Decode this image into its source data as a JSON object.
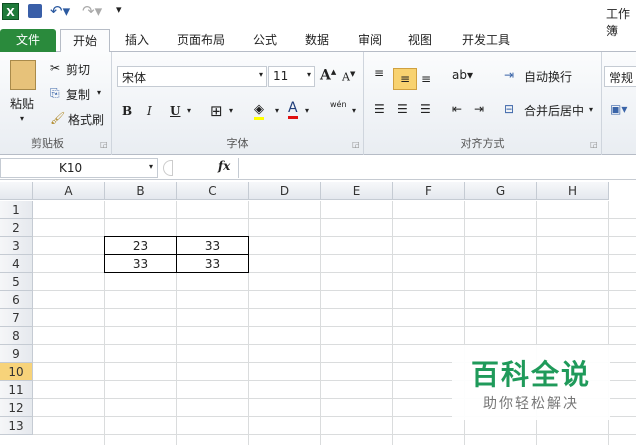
{
  "app": {
    "title": "工作簿"
  },
  "tabs": [
    {
      "label": "文件"
    },
    {
      "label": "开始"
    },
    {
      "label": "插入"
    },
    {
      "label": "页面布局"
    },
    {
      "label": "公式"
    },
    {
      "label": "数据"
    },
    {
      "label": "审阅"
    },
    {
      "label": "视图"
    },
    {
      "label": "开发工具"
    }
  ],
  "clipboard": {
    "paste": "粘贴",
    "cut": "剪切",
    "copy": "复制",
    "format_painter": "格式刷",
    "label": "剪贴板"
  },
  "font": {
    "name": "宋体",
    "size": "11",
    "bold": "B",
    "italic": "I",
    "underline": "U",
    "font_color": "A",
    "phonetic": "wén",
    "label": "字体"
  },
  "alignment": {
    "wrap": "自动换行",
    "merge": "合并后居中",
    "label": "对齐方式"
  },
  "number": {
    "format": "常规"
  },
  "formula_bar": {
    "name_box": "K10",
    "fx": "fx",
    "value": ""
  },
  "sheet": {
    "columns": [
      "A",
      "B",
      "C",
      "D",
      "E",
      "F",
      "G",
      "H"
    ],
    "rows": [
      "1",
      "2",
      "3",
      "4",
      "5",
      "6",
      "7",
      "8",
      "9",
      "10",
      "11",
      "12",
      "13"
    ],
    "active_row": "10",
    "cells": [
      {
        "ref": "B3",
        "value": "23"
      },
      {
        "ref": "C3",
        "value": "33"
      },
      {
        "ref": "B4",
        "value": "33"
      },
      {
        "ref": "C4",
        "value": "33"
      }
    ]
  },
  "watermark": {
    "title": "百科全说",
    "subtitle": "助你轻松解决"
  },
  "colors": {
    "file_tab": "#2a8a3c",
    "accent_highlight": "#f8d270",
    "active_row_header": "#f7d37a"
  }
}
